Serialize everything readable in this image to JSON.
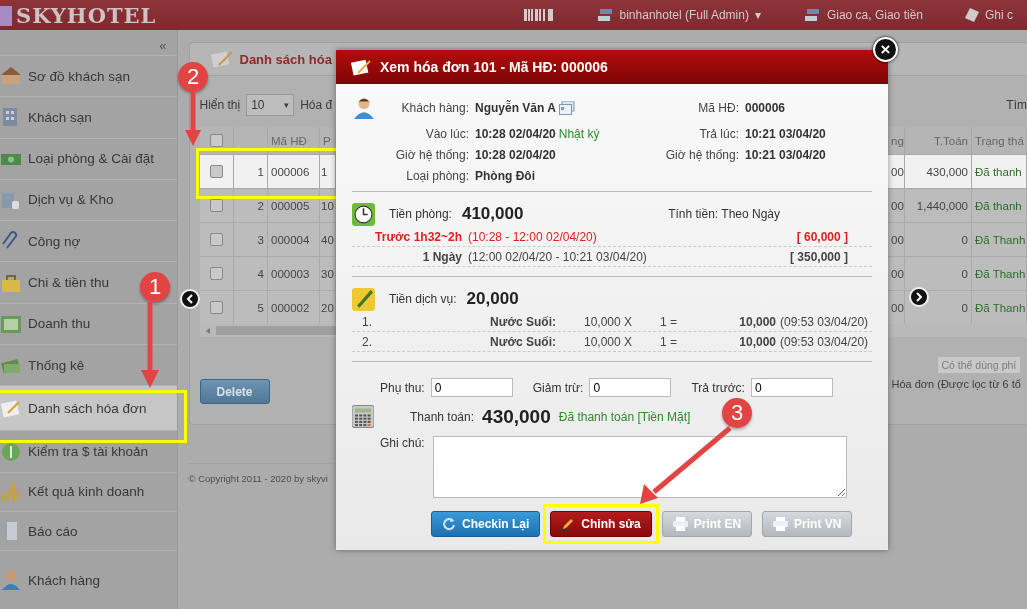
{
  "header": {
    "logo": "SKYHOTEL",
    "account": "binhanhotel (Full Admin)",
    "caret": "▾",
    "links": [
      "Giao ca, Giao tiền",
      "Ghi c"
    ]
  },
  "sidebar": {
    "collapse": "«",
    "items": [
      {
        "label": "Sơ đồ khách sạn",
        "selected": false
      },
      {
        "label": "Khách sạn",
        "selected": false
      },
      {
        "label": "Loại phòng & Cài đặt",
        "selected": false
      },
      {
        "label": "Dịch vụ & Kho",
        "selected": false
      },
      {
        "label": "Công nợ",
        "selected": false
      },
      {
        "label": "Chi & tiền thu",
        "selected": false
      },
      {
        "label": "Doanh thu",
        "selected": false
      },
      {
        "label": "Thống kê",
        "selected": false
      },
      {
        "label": "Danh sách hóa đơn",
        "selected": true
      },
      {
        "label": "Kiểm tra $ tài khoản",
        "selected": false
      },
      {
        "label": "Kết quả kinh doanh",
        "selected": false
      },
      {
        "label": "Báo cáo",
        "selected": false
      },
      {
        "label": "Khách hàng",
        "selected": false
      }
    ]
  },
  "panel": {
    "title": "Danh sách hóa",
    "show_label": "Hiển thị",
    "page_size": "10",
    "show_suffix": "Hóa đ",
    "search_label": "Tìm",
    "all_checked": false,
    "columns": [
      "",
      "Mã HĐ",
      "P",
      "ng",
      "T.Toán",
      "Trạng thá"
    ],
    "rows": [
      {
        "selected": true,
        "checked": false,
        "cells": [
          "1",
          "000006",
          "1",
          "00",
          "430,000",
          "Đã thanh"
        ]
      },
      {
        "selected": false,
        "checked": false,
        "cells": [
          "2",
          "000005",
          "10",
          "00",
          "1,440,000",
          "Đã thanh"
        ]
      },
      {
        "selected": false,
        "checked": false,
        "cells": [
          "3",
          "000004",
          "40",
          "00",
          "0",
          "Đã Thanh"
        ]
      },
      {
        "selected": false,
        "checked": false,
        "cells": [
          "4",
          "000003",
          "30",
          "00",
          "0",
          "Đã Thanh"
        ]
      },
      {
        "selected": false,
        "checked": false,
        "cells": [
          "5",
          "000002",
          "20",
          "00",
          "0",
          "Đã Thanh"
        ]
      }
    ],
    "hint": "Có thể dùng phí",
    "summary": "Hóa đơn (Được lọc từ 6 tổ",
    "delete": "Delete"
  },
  "copyright": "© Copyright 2011 - 2020 by skyvi",
  "modal": {
    "title": "Xem hóa đơn 101 - Mã HĐ: 000006",
    "close": "×",
    "info": [
      {
        "label": "Khách hàng:",
        "value": "Nguyễn Văn A",
        "card": true,
        "label2": "Mã HĐ:",
        "value2": "000006"
      },
      {
        "label": "Vào lúc:",
        "value": "10:28 02/04/20",
        "extra": "Nhật ký",
        "card": false,
        "label2": "Trả lúc:",
        "value2": "10:21 03/04/20"
      },
      {
        "label": "Giờ hệ thống:",
        "value": "10:28 02/04/20",
        "card": false,
        "label2": "Giờ hệ thống:",
        "value2": "10:21 03/04/20"
      },
      {
        "label": "Loại phòng:",
        "value": "Phòng Đôi",
        "card": false
      }
    ],
    "room": {
      "label": "Tiền phòng:",
      "amount": "410,000",
      "mode": "Tính tiền: Theo Ngày",
      "lines": [
        {
          "kind": "warning",
          "name": "Trước 1h32~2h",
          "range": "(10:28 - 12:00 02/04/20)",
          "price": "[ 60,000 ]"
        },
        {
          "kind": "normal",
          "name": "1 Ngày",
          "range": "(12:00 02/04/20 - 10:21 03/04/20)",
          "price": "[ 350,000 ]"
        }
      ]
    },
    "service": {
      "label": "Tiền dịch vụ:",
      "amount": "20,000",
      "lines": [
        {
          "no": "1.",
          "item": "Nước Suối:",
          "price": "10,000 X",
          "qty": "1 =",
          "total": "10,000",
          "time": "(09:53 03/04/20)"
        },
        {
          "no": "2.",
          "item": "Nước Suối:",
          "price": "10,000 X",
          "qty": "1 =",
          "total": "10,000",
          "time": "(09:53 03/04/20)"
        }
      ]
    },
    "fields": [
      {
        "label": "Phụ thu:",
        "value": "0"
      },
      {
        "label": "Giảm trừ:",
        "value": "0"
      },
      {
        "label": "Trả trước:",
        "value": "0"
      }
    ],
    "payment": {
      "label": "Thanh toán:",
      "amount": "430,000",
      "status": "Đã thanh toán [Tiền Mặt]"
    },
    "note": {
      "label": "Ghi chú:"
    },
    "buttons": [
      {
        "kind": "checkin",
        "label": "Checkin Lại"
      },
      {
        "kind": "edit",
        "label": "Chỉnh sửa"
      },
      {
        "kind": "print",
        "label": "Print EN"
      },
      {
        "kind": "print",
        "label": "Print VN"
      }
    ]
  },
  "annotations": [
    "1",
    "2",
    "3"
  ]
}
